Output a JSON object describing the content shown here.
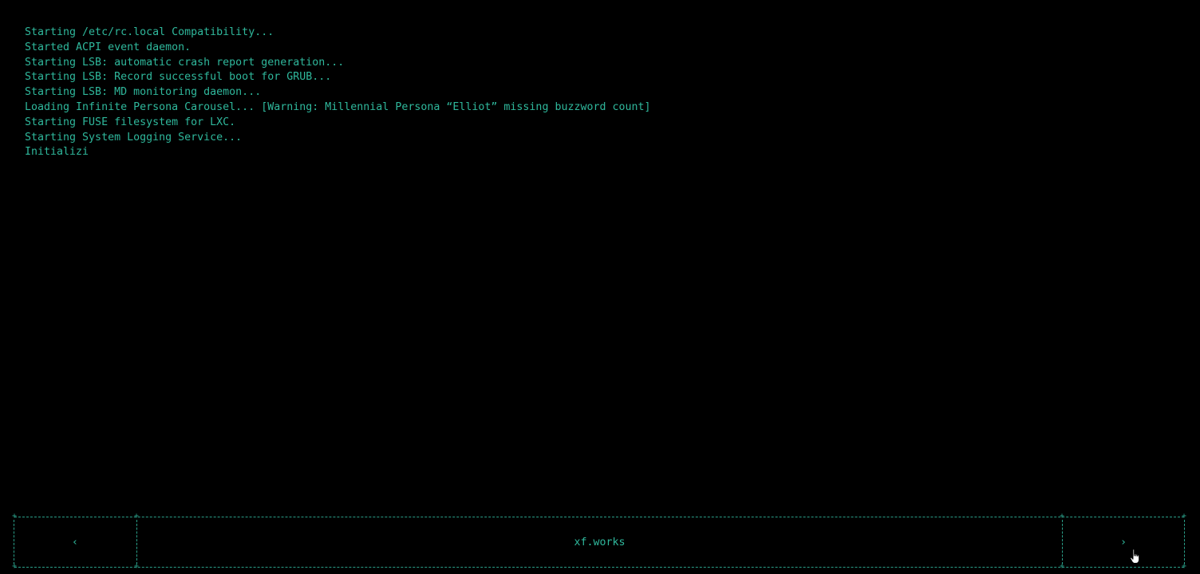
{
  "boot_log": [
    "Starting /etc/rc.local Compatibility...",
    "Started ACPI event daemon.",
    "Starting LSB: automatic crash report generation...",
    "Starting LSB: Record successful boot for GRUB...",
    "Starting LSB: MD monitoring daemon...",
    "Loading Infinite Persona Carousel... [Warning: Millennial Persona “Elliot” missing buzzword count]",
    "Starting FUSE filesystem for LXC.",
    "Starting System Logging Service...",
    "Initializi"
  ],
  "nav": {
    "prev_label": "‹",
    "brand": "xf.works",
    "next_label": "›"
  },
  "colors": {
    "background": "#000000",
    "text": "#2fb89c",
    "border": "#2a9e88"
  },
  "icons": {
    "cursor": "hand-pointer-icon"
  }
}
